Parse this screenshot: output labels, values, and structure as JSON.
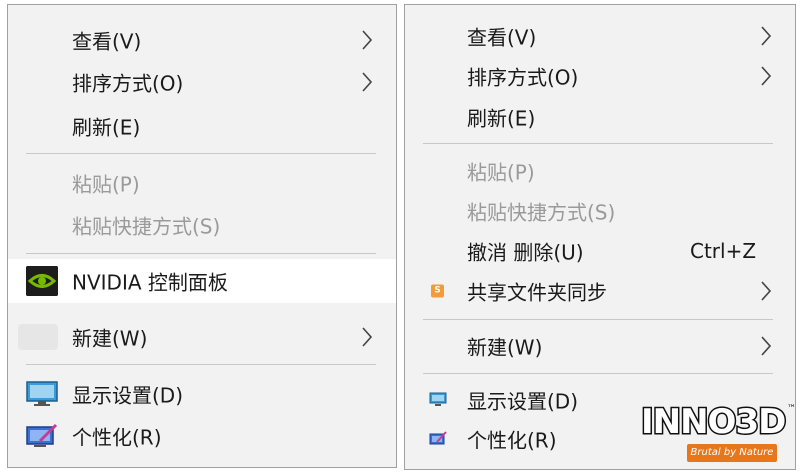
{
  "left_menu": {
    "view": "查看(V)",
    "sort": "排序方式(O)",
    "refresh": "刷新(E)",
    "paste": "粘贴(P)",
    "paste_shortcut": "粘贴快捷方式(S)",
    "nvidia": "NVIDIA 控制面板",
    "new": "新建(W)",
    "display": "显示设置(D)",
    "personalize": "个性化(R)"
  },
  "right_menu": {
    "view": "查看(V)",
    "sort": "排序方式(O)",
    "refresh": "刷新(E)",
    "paste": "粘贴(P)",
    "paste_shortcut": "粘贴快捷方式(S)",
    "undo_delete": "撤消 删除(U)",
    "undo_shortcut": "Ctrl+Z",
    "share_sync": "共享文件夹同步",
    "new": "新建(W)",
    "display": "显示设置(D)",
    "personalize": "个性化(R)"
  },
  "brand": {
    "name": "INNO3D",
    "trademark": "™",
    "tagline": "Brutal by Nature"
  },
  "colors": {
    "menu_bg": "#f2f2f2",
    "highlight": "#ffffff",
    "disabled_text": "#9a9a9a",
    "nvidia_green": "#76b900",
    "brand_orange": "#e8771c"
  }
}
